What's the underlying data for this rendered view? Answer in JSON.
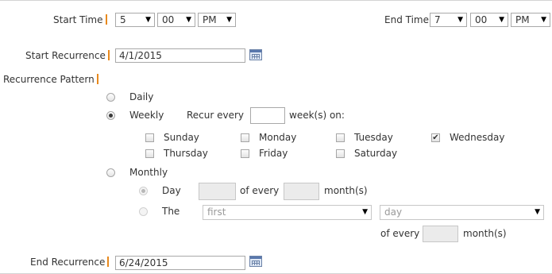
{
  "time": {
    "start_label": "Start Time",
    "start_hour": "5",
    "start_minute": "00",
    "start_ampm": "PM",
    "end_label": "End Time",
    "end_hour": "7",
    "end_minute": "00",
    "end_ampm": "PM"
  },
  "start_recurrence": {
    "label": "Start Recurrence",
    "value": "4/1/2015"
  },
  "pattern": {
    "label": "Recurrence Pattern",
    "options": [
      "Daily",
      "Weekly",
      "Monthly"
    ],
    "selected": "Weekly",
    "weekly": {
      "recur_every_label": "Recur every",
      "recur_every_value": "",
      "weeks_on_label": "week(s) on:",
      "days": [
        {
          "name": "Sunday",
          "checked": false
        },
        {
          "name": "Monday",
          "checked": false
        },
        {
          "name": "Tuesday",
          "checked": false
        },
        {
          "name": "Wednesday",
          "checked": true
        },
        {
          "name": "Thursday",
          "checked": false
        },
        {
          "name": "Friday",
          "checked": false
        },
        {
          "name": "Saturday",
          "checked": false
        }
      ]
    },
    "monthly": {
      "day_label": "Day",
      "day_value": "",
      "of_every_label": "of every",
      "months_value": "",
      "months_label": "month(s)",
      "the_label": "The",
      "ordinal_value": "first",
      "dayname_value": "day",
      "of_every_label2": "of every",
      "months_value2": "",
      "months_label2": "month(s)",
      "selected": "Day"
    }
  },
  "end_recurrence": {
    "label": "End Recurrence",
    "value": "6/24/2015"
  },
  "icons": {
    "dropdown": "▼",
    "check": "✔",
    "calendar": "calendar-icon"
  },
  "colors": {
    "required_marker": "#e8891d",
    "border": "#a9a9a9",
    "disabled_field": "#ebebeb"
  }
}
